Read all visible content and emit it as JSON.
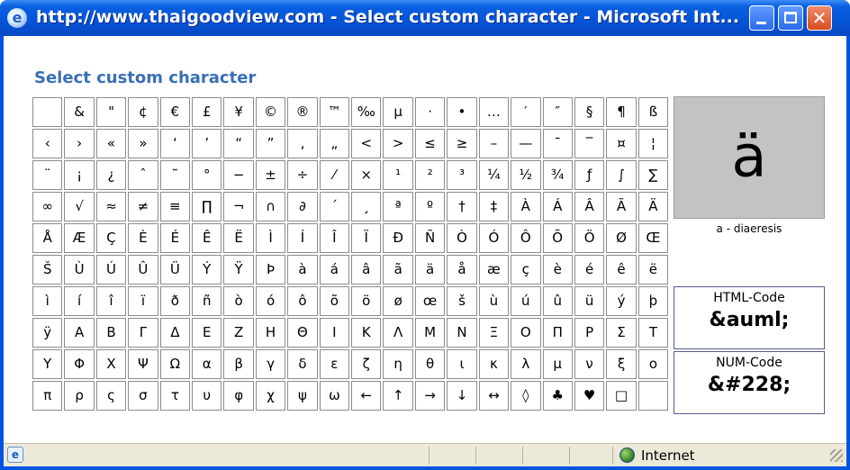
{
  "window": {
    "title": "http://www.thaigoodview.com - Select custom character - Microsoft Int...",
    "icons": [
      "ie-icon",
      "minimize-icon",
      "maximize-icon",
      "close-icon"
    ]
  },
  "heading": "Select custom character",
  "grid": {
    "rows": [
      [
        "",
        "&",
        "\"",
        "¢",
        "€",
        "£",
        "¥",
        "©",
        "®",
        "™",
        "‰",
        "µ",
        "·",
        "•",
        "…",
        "′",
        "″",
        "§",
        "¶",
        "ß"
      ],
      [
        "‹",
        "›",
        "«",
        "»",
        "‘",
        "’",
        "“",
        "”",
        "‚",
        "„",
        "<",
        ">",
        "≤",
        "≥",
        "–",
        "—",
        "¯",
        "‾",
        "¤",
        "¦"
      ],
      [
        "¨",
        "¡",
        "¿",
        "ˆ",
        "˜",
        "°",
        "−",
        "±",
        "÷",
        "⁄",
        "×",
        "¹",
        "²",
        "³",
        "¼",
        "½",
        "¾",
        "ƒ",
        "∫",
        "∑"
      ],
      [
        "∞",
        "√",
        "≈",
        "≠",
        "≡",
        "∏",
        "¬",
        "∩",
        "∂",
        "´",
        "¸",
        "ª",
        "º",
        "†",
        "‡",
        "À",
        "Á",
        "Â",
        "Ã",
        "Ä"
      ],
      [
        "Å",
        "Æ",
        "Ç",
        "È",
        "É",
        "Ê",
        "Ë",
        "Ì",
        "Í",
        "Î",
        "Ï",
        "Ð",
        "Ñ",
        "Ò",
        "Ó",
        "Ô",
        "Õ",
        "Ö",
        "Ø",
        "Œ"
      ],
      [
        "Š",
        "Ù",
        "Ú",
        "Û",
        "Ü",
        "Ý",
        "Ÿ",
        "Þ",
        "à",
        "á",
        "â",
        "ã",
        "ä",
        "å",
        "æ",
        "ç",
        "è",
        "é",
        "ê",
        "ë"
      ],
      [
        "ì",
        "í",
        "î",
        "ï",
        "ð",
        "ñ",
        "ò",
        "ó",
        "ô",
        "õ",
        "ö",
        "ø",
        "œ",
        "š",
        "ù",
        "ú",
        "û",
        "ü",
        "ý",
        "þ"
      ],
      [
        "ÿ",
        "Α",
        "Β",
        "Γ",
        "Δ",
        "Ε",
        "Ζ",
        "Η",
        "Θ",
        "Ι",
        "Κ",
        "Λ",
        "Μ",
        "Ν",
        "Ξ",
        "Ο",
        "Π",
        "Ρ",
        "Σ",
        "Τ"
      ],
      [
        "Υ",
        "Φ",
        "Χ",
        "Ψ",
        "Ω",
        "α",
        "β",
        "γ",
        "δ",
        "ε",
        "ζ",
        "η",
        "θ",
        "ι",
        "κ",
        "λ",
        "μ",
        "ν",
        "ξ",
        "ο"
      ],
      [
        "π",
        "ρ",
        "ς",
        "σ",
        "τ",
        "υ",
        "φ",
        "χ",
        "ψ",
        "ω",
        "←",
        "↑",
        "→",
        "↓",
        "↔",
        "◊",
        "♣",
        "♥",
        "□",
        ""
      ]
    ]
  },
  "preview": {
    "char": "ä",
    "name": "a - diaeresis",
    "html_label": "HTML-Code",
    "html_code": "&auml;",
    "num_label": "NUM-Code",
    "num_code": "&#228;"
  },
  "statusbar": {
    "zone": "Internet",
    "icons": [
      "page-icon",
      "internet-zone-icon",
      "resize-grip-icon"
    ]
  },
  "colors": {
    "titlebar": "#0a5fe0",
    "heading": "#3a6fb5",
    "preview_bg": "#c3c3c3",
    "close_button": "#d94a1f"
  }
}
